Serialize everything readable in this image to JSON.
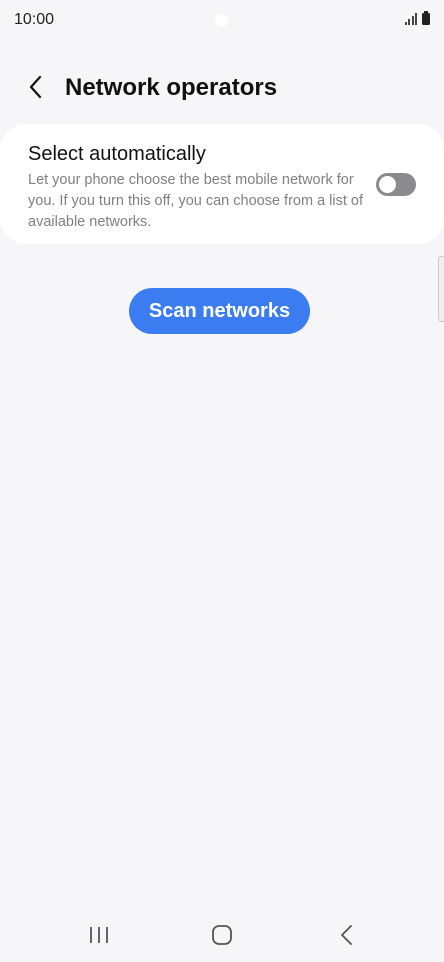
{
  "status_bar": {
    "time": "10:00",
    "icons": [
      "signal-icon",
      "battery-icon"
    ]
  },
  "header": {
    "back_icon": "chevron-left-icon",
    "title": "Network operators"
  },
  "auto_select": {
    "title": "Select automatically",
    "description": "Let your phone choose the best mobile network for you. If you turn this off, you can choose from a list of available networks.",
    "enabled": false
  },
  "scan_button": {
    "label": "Scan networks"
  },
  "nav_bar": {
    "icons": [
      "recent-apps-icon",
      "home-icon",
      "back-icon"
    ]
  },
  "colors": {
    "background": "#f6f6f8",
    "accent": "#3b7cf0",
    "toggle_off": "#8a8a8f",
    "secondary_text": "#808080"
  }
}
